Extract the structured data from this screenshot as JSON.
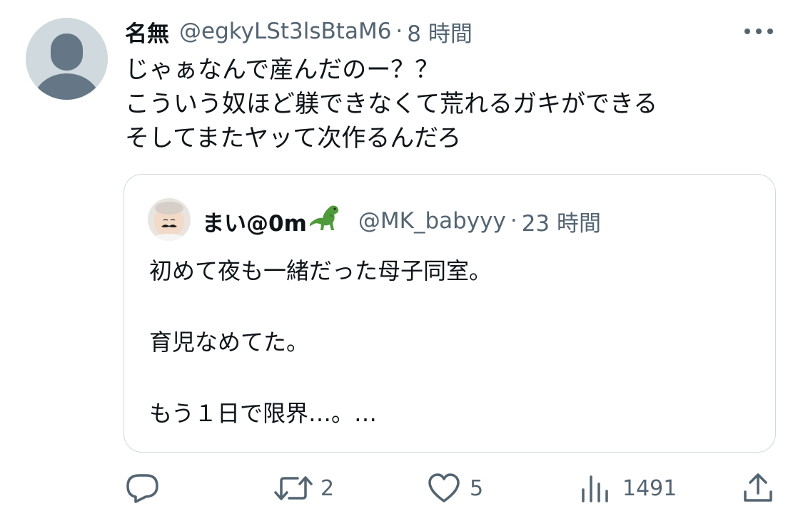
{
  "tweet": {
    "author_name": "名無",
    "handle": "@egkyLSt3lsBtaM6",
    "separator": "·",
    "time": "8 時間",
    "text": "じゃぁなんで産んだのー？？\nこういう奴ほど躾できなくて荒れるガキができる\nそしてまたヤッて次作るんだろ"
  },
  "quoted_tweet": {
    "author_name": "まい@0m",
    "emoji": "🦖",
    "handle": "@MK_babyyy",
    "separator": "·",
    "time": "23 時間",
    "text": "初めて夜も一緒だった母子同室。\n\n育児なめてた。\n\nもう１日で限界…。…"
  },
  "actions": {
    "replies": "",
    "retweets": "2",
    "likes": "5",
    "views": "1491"
  },
  "icons": {
    "more": "more-horizontal-icon",
    "reply": "reply-bubble-icon",
    "retweet": "retweet-icon",
    "like": "heart-icon",
    "views": "bar-chart-icon",
    "share": "share-upload-icon"
  },
  "colors": {
    "text": "#0f1419",
    "secondary": "#536471",
    "border": "#cfd9de",
    "avatar_placeholder": "#cfd9de"
  }
}
